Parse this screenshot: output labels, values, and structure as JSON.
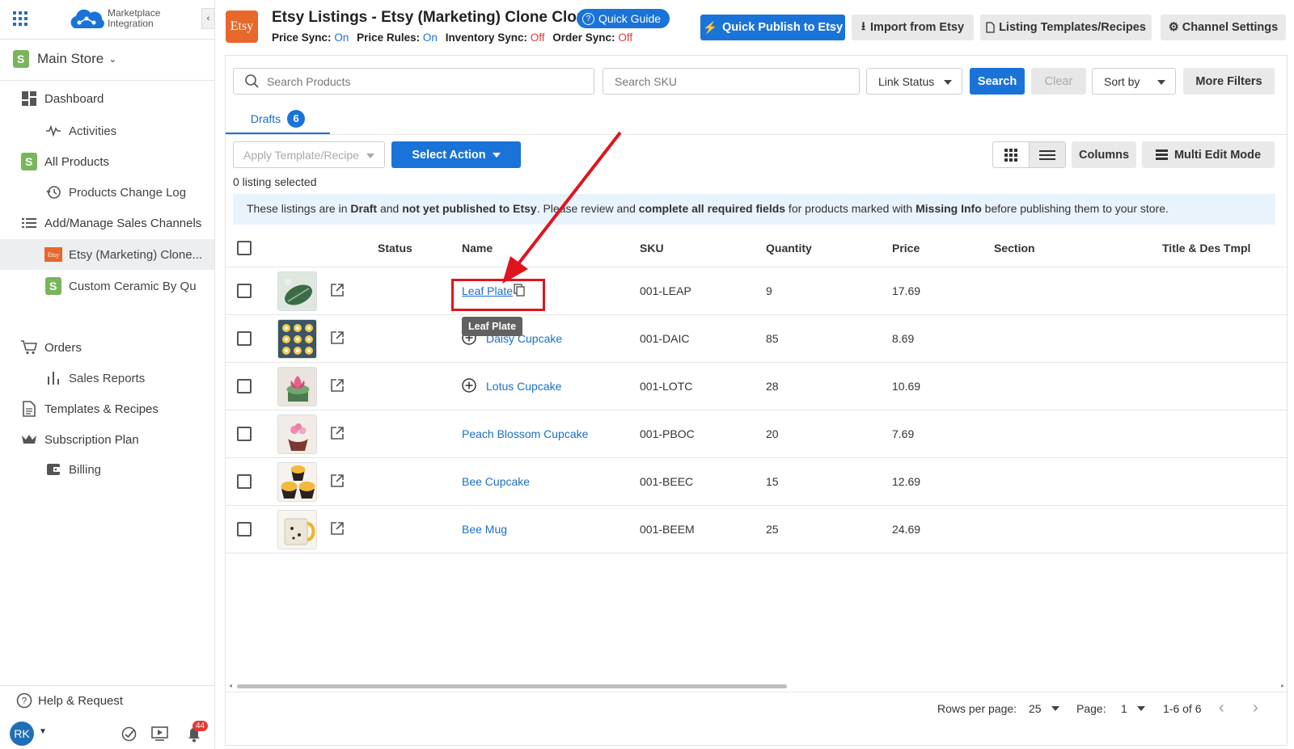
{
  "brand": {
    "name_line1": "Marketplace",
    "name_line2": "Integration"
  },
  "store": {
    "name": "Main Store"
  },
  "sidebar": {
    "items": [
      {
        "label": "Dashboard",
        "icon": "dashboard-icon"
      },
      {
        "label": "Activities",
        "icon": "activity-icon"
      },
      {
        "label": "All Products",
        "icon": "shopify-icon"
      },
      {
        "label": "Products Change Log",
        "icon": "history-icon"
      },
      {
        "label": "Add/Manage Sales Channels",
        "icon": "list-icon"
      },
      {
        "label": "Etsy (Marketing) Clone...",
        "icon": "etsy-icon"
      },
      {
        "label": "Custom Ceramic By Qu",
        "icon": "shopify-icon"
      },
      {
        "label": "Orders",
        "icon": "cart-icon"
      },
      {
        "label": "Sales Reports",
        "icon": "bar-chart-icon"
      },
      {
        "label": "Templates & Recipes",
        "icon": "document-icon"
      },
      {
        "label": "Subscription Plan",
        "icon": "crown-icon"
      },
      {
        "label": "Billing",
        "icon": "wallet-icon"
      }
    ],
    "help": "Help & Request",
    "avatar": "RK",
    "notifications": "44"
  },
  "header": {
    "logo": "Etsy",
    "title": "Etsy Listings - Etsy (Marketing) Clone Clone",
    "quick_guide": "Quick Guide",
    "sync": {
      "price_sync_label": "Price Sync:",
      "price_sync": "On",
      "price_rules_label": "Price Rules:",
      "price_rules": "On",
      "inventory_sync_label": "Inventory Sync:",
      "inventory_sync": "Off",
      "order_sync_label": "Order Sync:",
      "order_sync": "Off"
    },
    "buttons": {
      "publish": "Quick Publish to Etsy",
      "import": "Import from Etsy",
      "templates": "Listing Templates/Recipes",
      "settings": "Channel Settings"
    }
  },
  "filters": {
    "search_products": "Search Products",
    "search_sku": "Search SKU",
    "link_status": "Link Status",
    "search": "Search",
    "clear": "Clear",
    "sort_by": "Sort by",
    "more_filters": "More Filters"
  },
  "tabs": [
    {
      "label": "Drafts",
      "count": "6"
    }
  ],
  "toolbar": {
    "apply_template": "Apply Template/Recipe",
    "select_action": "Select Action",
    "columns": "Columns",
    "multi_edit": "Multi Edit Mode",
    "selected": "0 listing selected"
  },
  "notice": {
    "p1": "These listings are in ",
    "b1": "Draft",
    "p2": " and ",
    "b2": "not yet published to Etsy",
    "p3": ". Please review and ",
    "b3": "complete all required fields",
    "p4": " for products marked with ",
    "b4": "Missing Info",
    "p5": " before publishing them to your store."
  },
  "table": {
    "columns": [
      "Status",
      "Name",
      "SKU",
      "Quantity",
      "Price",
      "Section",
      "Title & Des Tmpl"
    ],
    "rows": [
      {
        "name": "Leaf Plate",
        "sku": "001-LEAP",
        "quantity": "9",
        "price": "17.69"
      },
      {
        "name": "Daisy Cupcake",
        "sku": "001-DAIC",
        "quantity": "85",
        "price": "8.69"
      },
      {
        "name": "Lotus Cupcake",
        "sku": "001-LOTC",
        "quantity": "28",
        "price": "10.69"
      },
      {
        "name": "Peach Blossom Cupcake",
        "sku": "001-PBOC",
        "quantity": "20",
        "price": "7.69"
      },
      {
        "name": "Bee Cupcake",
        "sku": "001-BEEC",
        "quantity": "15",
        "price": "12.69"
      },
      {
        "name": "Bee Mug",
        "sku": "001-BEEM",
        "quantity": "25",
        "price": "24.69"
      }
    ],
    "tooltip": "Leaf Plate"
  },
  "pagination": {
    "rows_label": "Rows per page:",
    "rows_value": "25",
    "page_label": "Page:",
    "page_value": "1",
    "range": "1-6 of 6"
  },
  "colors": {
    "accent": "#1a73d9",
    "etsy": "#e8672a",
    "highlight": "#e0141e"
  }
}
